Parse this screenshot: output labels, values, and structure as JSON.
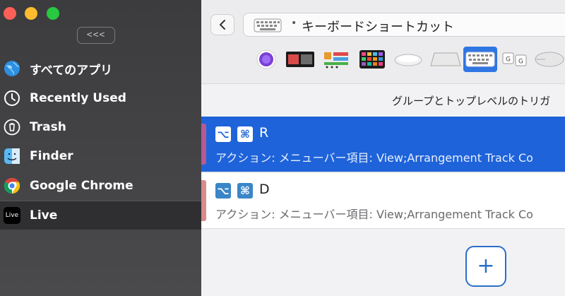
{
  "sidebar": {
    "collapse_label": "<<<",
    "items": [
      {
        "label": "すべてのアプリ",
        "icon": "globe-icon"
      },
      {
        "label": "Recently Used",
        "icon": "clock-icon"
      },
      {
        "label": "Trash",
        "icon": "trash-icon"
      },
      {
        "label": "Finder",
        "icon": "finder-icon"
      },
      {
        "label": "Google Chrome",
        "icon": "chrome-icon"
      },
      {
        "label": "Live",
        "icon": "live-icon",
        "selected": true,
        "badge": "Live"
      }
    ]
  },
  "toolbar": {
    "path_text": "キーボードショートカット",
    "path_separator": "•",
    "trigger_icons": [
      "siri-icon",
      "touch-bar-icon",
      "stream-deck-icon",
      "midi-pad-icon",
      "magic-mouse-icon",
      "trackpad-icon",
      "keyboard-icon",
      "key-sequence-icon",
      "mouse-icon"
    ],
    "selected_trigger": "keyboard-icon",
    "key_sequence_glyphs": [
      "G",
      "G"
    ]
  },
  "list": {
    "group_header": "グループとトップレベルのトリガ",
    "rows": [
      {
        "modifiers": [
          "⌥",
          "⌘"
        ],
        "key": "R",
        "action": "アクション: メニューバー項目: View;Arrangement Track Co",
        "selected": true
      },
      {
        "modifiers": [
          "⌥",
          "⌘"
        ],
        "key": "D",
        "action": "アクション: メニューバー項目: View;Arrangement Track Co",
        "selected": false
      }
    ]
  },
  "add_button_label": "+",
  "colors": {
    "selection": "#1e63d9",
    "accent": "#2a6fc8"
  }
}
